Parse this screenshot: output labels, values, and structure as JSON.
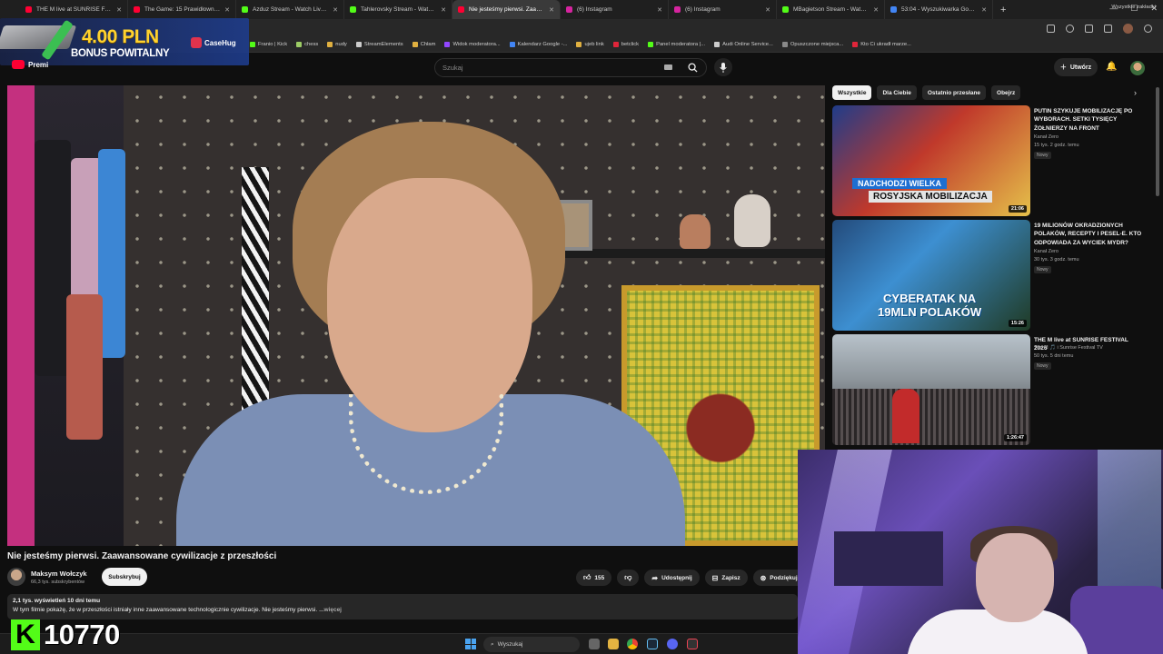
{
  "browser": {
    "tabs": [
      {
        "title": "THE M live at SUNRISE FESTIVAL",
        "fav": "#ff0033",
        "active": false
      },
      {
        "title": "The Game: 15 Prawidłowników vs",
        "fav": "#ff0033",
        "active": false
      },
      {
        "title": "Azduz Stream - Watch Live on K",
        "fav": "#53fc18",
        "active": false
      },
      {
        "title": "Tahlerovsky Stream - Watch Liv",
        "fav": "#53fc18",
        "active": false
      },
      {
        "title": "Nie jesteśmy pierwsi. Zaawans",
        "fav": "#ff0033",
        "active": true
      },
      {
        "title": "(6) Instagram",
        "fav": "#d6249f",
        "active": false
      },
      {
        "title": "(6) Instagram",
        "fav": "#d6249f",
        "active": false
      },
      {
        "title": "MBagietson Stream - Watch Liv",
        "fav": "#53fc18",
        "active": false
      },
      {
        "title": "53:04 - Wyszukiwarka Google",
        "fav": "#4285f4",
        "active": false
      }
    ],
    "new_tab": "+",
    "window_controls": [
      "—",
      "☐",
      "✕"
    ],
    "bookmarks": [
      {
        "label": "Franio | Kick",
        "color": "#53fc18"
      },
      {
        "label": "chess",
        "color": "#9ccc65"
      },
      {
        "label": "nudy",
        "color": "#e0b040"
      },
      {
        "label": "StreamElements",
        "color": "#cccccc"
      },
      {
        "label": "Chłam",
        "color": "#e0b040"
      },
      {
        "label": "Widok moderatora...",
        "color": "#9146ff"
      },
      {
        "label": "Kalendarz Google -...",
        "color": "#4285f4"
      },
      {
        "label": "ujeb link",
        "color": "#e0b040"
      },
      {
        "label": "betclick",
        "color": "#e0253a"
      },
      {
        "label": "Panel moderatora |...",
        "color": "#53fc18"
      },
      {
        "label": "Audi Online Service...",
        "color": "#cccccc"
      },
      {
        "label": "Opuszczone miejsca...",
        "color": "#888888"
      },
      {
        "label": "Kto Ci ukradł marze...",
        "color": "#e0253a"
      }
    ],
    "all_bookmarks": "Wszystkie zakładki"
  },
  "promo": {
    "amount": "4.00 PLN",
    "subtitle": "BONUS POWITALNY",
    "brand": "CaseHug"
  },
  "youtube": {
    "premium_label": "Premi",
    "search_placeholder": "Szukaj",
    "create_label": "Utwórz"
  },
  "video": {
    "title": "Nie jesteśmy pierwsi. Zaawansowane cywilizacje z przeszłości",
    "channel": "Maksym Wołczyk",
    "subscribers": "66,3 tys. subskrybentów",
    "subscribe_label": "Subskrybuj",
    "likes": "155",
    "share_label": "Udostępnij",
    "save_label": "Zapisz",
    "thanks_label": "Podziękuj",
    "views_date": "2,1 tys. wyświetleń  10 dni temu",
    "description": "W tym filmie pokażę, że w przeszłości istniały inne zaawansowane technologicznie cywilizacje. Nie jesteśmy pierwsi.",
    "more_label": "...więcej"
  },
  "chips": [
    "Wszystkie",
    "Dla Ciebie",
    "Ostatnio przesłane",
    "Obejrz"
  ],
  "recommendations": [
    {
      "title": "PUTIN SZYKUJE MOBILIZACJĘ PO WYBORACH. SETKI TYSIĘCY ŻOŁNIERZY NA FRONT",
      "channel": "Kanał Zero",
      "meta": "15 tys.  2 godz. temu",
      "badge": "Nowy",
      "duration": "21:06",
      "thumb_caption_1": "NADCHODZI WIELKA",
      "thumb_caption_2": "ROSYJSKA MOBILIZACJA"
    },
    {
      "title": "19 MILIONÓW OKRADZIONYCH POLAKÓW, RECEPTY I PESEL-E. KTO ODPOWIADA ZA WYCIEK MYDR?",
      "channel": "Kanał Zero",
      "meta": "30 tys.  3 godz. temu",
      "badge": "Nowy",
      "duration": "15:26",
      "thumb_caption_1": "CYBERATAK NA",
      "thumb_caption_2": "19MLN POLAKÓW"
    },
    {
      "title": "THE M live at SUNRISE FESTIVAL 2026",
      "channel": "The M 🎵 i Sunrise Festival TV",
      "meta": "50 tys.  5 dni temu",
      "badge": "Nowy",
      "duration": "1:26:47"
    }
  ],
  "taskbar": {
    "search_label": "Wyszukaj"
  },
  "overlay": {
    "kick_letter": "K",
    "follower_count": "10770"
  }
}
